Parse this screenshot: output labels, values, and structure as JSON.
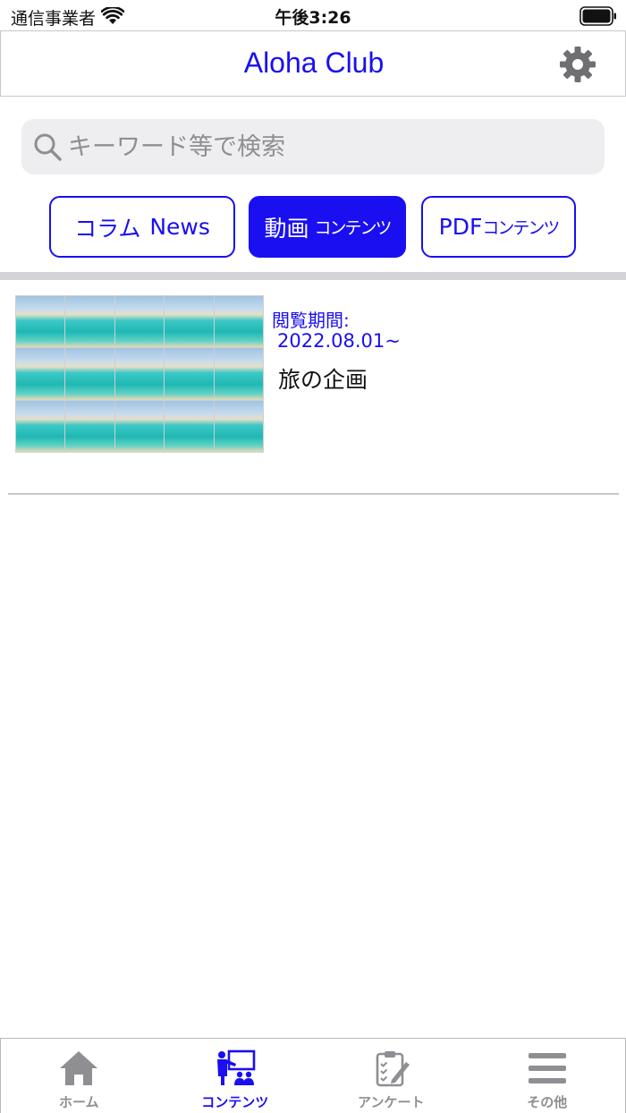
{
  "status_bar": {
    "carrier": "通信事業者",
    "time": "午後3:26"
  },
  "header": {
    "title": "Aloha Club",
    "title_color": "#1A0FF0"
  },
  "search": {
    "placeholder": "キーワード等で検索",
    "value": ""
  },
  "categories": [
    {
      "main": "コラム",
      "sub": "News",
      "active": false
    },
    {
      "main": "動画",
      "sub": "コンテンツ",
      "active": true
    },
    {
      "main": "PDF",
      "sub": "コンテンツ",
      "active": false
    }
  ],
  "items": [
    {
      "period_label": "閲覧期間:",
      "period_date": "2022.08.01~",
      "title": "旅の企画",
      "thumbnail": "beach-photo-collage"
    }
  ],
  "tab_bar": {
    "tabs": [
      {
        "label": "ホーム",
        "icon": "home-icon",
        "active": false
      },
      {
        "label": "コンテンツ",
        "icon": "presenter-icon",
        "active": true
      },
      {
        "label": "アンケート",
        "icon": "clipboard-icon",
        "active": false
      },
      {
        "label": "その他",
        "icon": "menu-icon",
        "active": false
      }
    ]
  },
  "colors": {
    "accent": "#1A0FF0",
    "inactive_tab": "#8E8E93",
    "divider": "#D4D4D8"
  }
}
